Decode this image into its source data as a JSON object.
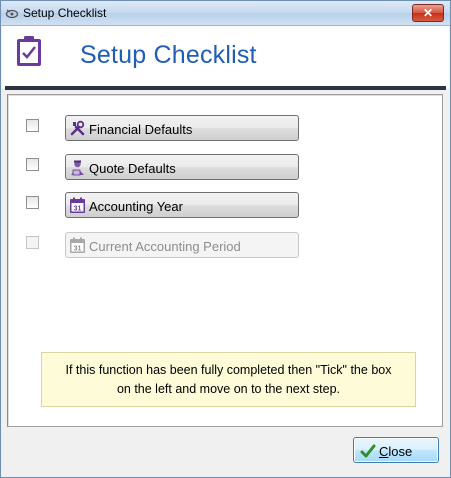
{
  "window": {
    "title": "Setup Checklist",
    "close_glyph": "✕"
  },
  "header": {
    "heading": "Setup Checklist",
    "logo_icon": "clipboard-check-icon",
    "accent": "#6a3b9c"
  },
  "steps": [
    {
      "label": "Financial Defaults",
      "icon": "tools-icon",
      "checked": false,
      "enabled": true
    },
    {
      "label": "Quote Defaults",
      "icon": "quote-user-icon",
      "checked": false,
      "enabled": true
    },
    {
      "label": "Accounting Year",
      "icon": "calendar-icon",
      "checked": false,
      "enabled": true
    },
    {
      "label": "Current Accounting Period",
      "icon": "calendar-icon",
      "checked": false,
      "enabled": false
    }
  ],
  "note": {
    "line1": "If this function has been fully completed then \"Tick\" the box",
    "line2": "on the left and move on to the next step."
  },
  "footer": {
    "close_label_first": "C",
    "close_label_rest": "lose",
    "close_icon": "check-icon"
  }
}
